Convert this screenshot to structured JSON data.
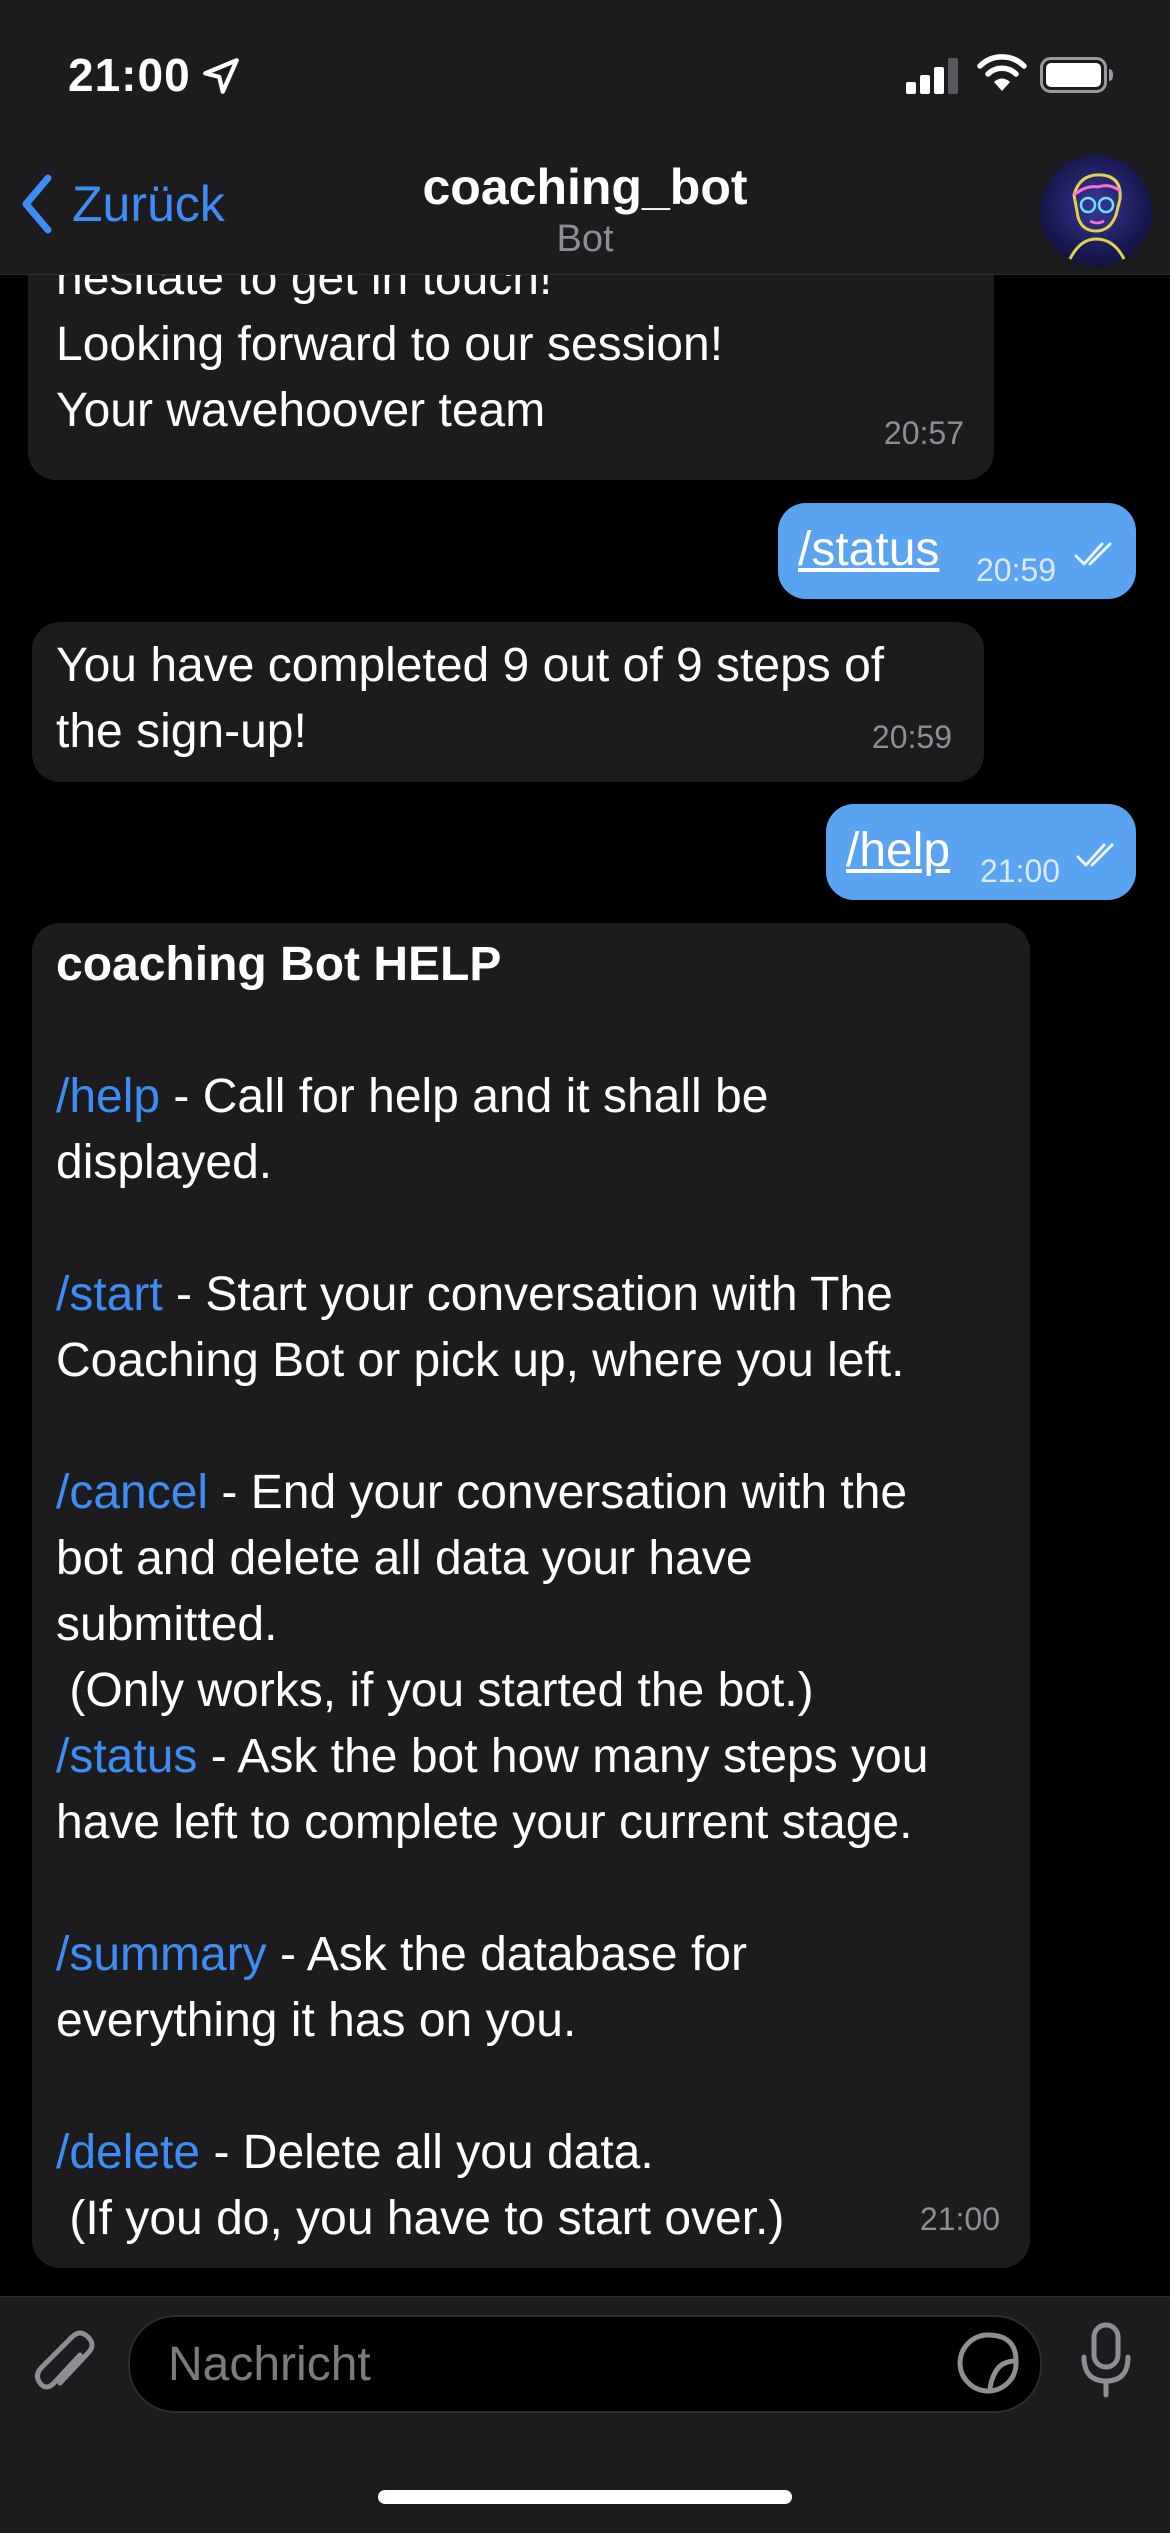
{
  "status_bar": {
    "time": "21:00"
  },
  "nav": {
    "back_label": "Zurück",
    "title": "coaching_bot",
    "subtitle": "Bot"
  },
  "messages": [
    {
      "from": "bot",
      "text": "hesitate to get in touch!\nLooking forward to our session!\nYour wavehoover team",
      "time": "20:57"
    },
    {
      "from": "user",
      "text": "/status",
      "time": "20:59"
    },
    {
      "from": "bot",
      "text": "You have completed 9 out of 9 steps of\nthe sign-up!",
      "time": "20:59"
    },
    {
      "from": "user",
      "text": "/help",
      "time": "21:00"
    },
    {
      "from": "bot",
      "time": "21:00",
      "help": {
        "heading": "coaching Bot HELP",
        "cmd_help": "/help",
        "desc_help": " - Call for help and it shall be\ndisplayed.",
        "cmd_start": "/start",
        "desc_start": " - Start your conversation with The\nCoaching Bot or pick up, where you left.",
        "cmd_cancel": "/cancel",
        "desc_cancel": " - End your conversation with the\nbot and delete all data your have\nsubmitted.\n (Only works, if you started the bot.)",
        "cmd_status": "/status",
        "desc_status": " - Ask the bot how many steps you\nhave left to complete your current stage.",
        "cmd_summary": "/summary",
        "desc_summary": " - Ask the database for\neverything it has on you.",
        "cmd_delete": "/delete",
        "desc_delete": " - Delete all you data.\n (If you do, you have to start over.)"
      }
    }
  ],
  "composer": {
    "placeholder": "Nachricht"
  },
  "icons": {
    "location": "location-arrow-icon",
    "signal": "cellular-signal-icon",
    "wifi": "wifi-icon",
    "battery": "battery-icon",
    "back": "chevron-left-icon",
    "attach": "paperclip-icon",
    "sticker": "sticker-icon",
    "mic": "microphone-icon"
  },
  "colors": {
    "accent": "#3d8df5",
    "outgoing_bubble": "#5aa3f1",
    "incoming_bubble": "#1c1c1e",
    "background": "#000000"
  }
}
